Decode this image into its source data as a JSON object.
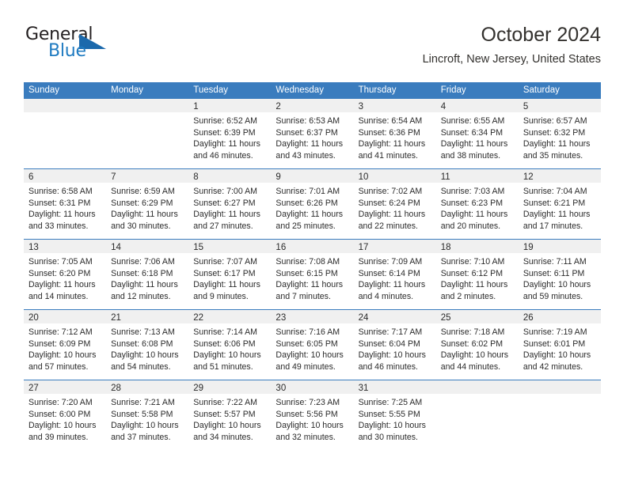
{
  "brand": {
    "name_part1": "General",
    "name_part2": "Blue",
    "triangle_icon": "triangle-icon",
    "accent_color": "#1b69ac"
  },
  "header": {
    "title": "October 2024",
    "location": "Lincroft, New Jersey, United States"
  },
  "calendar": {
    "header_bg": "#3a7cbe",
    "day_band_bg": "#f0f0f0",
    "weekdays": [
      "Sunday",
      "Monday",
      "Tuesday",
      "Wednesday",
      "Thursday",
      "Friday",
      "Saturday"
    ],
    "weeks": [
      [
        {
          "day": "",
          "lines": []
        },
        {
          "day": "",
          "lines": []
        },
        {
          "day": "1",
          "lines": [
            "Sunrise: 6:52 AM",
            "Sunset: 6:39 PM",
            "Daylight: 11 hours",
            "and 46 minutes."
          ]
        },
        {
          "day": "2",
          "lines": [
            "Sunrise: 6:53 AM",
            "Sunset: 6:37 PM",
            "Daylight: 11 hours",
            "and 43 minutes."
          ]
        },
        {
          "day": "3",
          "lines": [
            "Sunrise: 6:54 AM",
            "Sunset: 6:36 PM",
            "Daylight: 11 hours",
            "and 41 minutes."
          ]
        },
        {
          "day": "4",
          "lines": [
            "Sunrise: 6:55 AM",
            "Sunset: 6:34 PM",
            "Daylight: 11 hours",
            "and 38 minutes."
          ]
        },
        {
          "day": "5",
          "lines": [
            "Sunrise: 6:57 AM",
            "Sunset: 6:32 PM",
            "Daylight: 11 hours",
            "and 35 minutes."
          ]
        }
      ],
      [
        {
          "day": "6",
          "lines": [
            "Sunrise: 6:58 AM",
            "Sunset: 6:31 PM",
            "Daylight: 11 hours",
            "and 33 minutes."
          ]
        },
        {
          "day": "7",
          "lines": [
            "Sunrise: 6:59 AM",
            "Sunset: 6:29 PM",
            "Daylight: 11 hours",
            "and 30 minutes."
          ]
        },
        {
          "day": "8",
          "lines": [
            "Sunrise: 7:00 AM",
            "Sunset: 6:27 PM",
            "Daylight: 11 hours",
            "and 27 minutes."
          ]
        },
        {
          "day": "9",
          "lines": [
            "Sunrise: 7:01 AM",
            "Sunset: 6:26 PM",
            "Daylight: 11 hours",
            "and 25 minutes."
          ]
        },
        {
          "day": "10",
          "lines": [
            "Sunrise: 7:02 AM",
            "Sunset: 6:24 PM",
            "Daylight: 11 hours",
            "and 22 minutes."
          ]
        },
        {
          "day": "11",
          "lines": [
            "Sunrise: 7:03 AM",
            "Sunset: 6:23 PM",
            "Daylight: 11 hours",
            "and 20 minutes."
          ]
        },
        {
          "day": "12",
          "lines": [
            "Sunrise: 7:04 AM",
            "Sunset: 6:21 PM",
            "Daylight: 11 hours",
            "and 17 minutes."
          ]
        }
      ],
      [
        {
          "day": "13",
          "lines": [
            "Sunrise: 7:05 AM",
            "Sunset: 6:20 PM",
            "Daylight: 11 hours",
            "and 14 minutes."
          ]
        },
        {
          "day": "14",
          "lines": [
            "Sunrise: 7:06 AM",
            "Sunset: 6:18 PM",
            "Daylight: 11 hours",
            "and 12 minutes."
          ]
        },
        {
          "day": "15",
          "lines": [
            "Sunrise: 7:07 AM",
            "Sunset: 6:17 PM",
            "Daylight: 11 hours",
            "and 9 minutes."
          ]
        },
        {
          "day": "16",
          "lines": [
            "Sunrise: 7:08 AM",
            "Sunset: 6:15 PM",
            "Daylight: 11 hours",
            "and 7 minutes."
          ]
        },
        {
          "day": "17",
          "lines": [
            "Sunrise: 7:09 AM",
            "Sunset: 6:14 PM",
            "Daylight: 11 hours",
            "and 4 minutes."
          ]
        },
        {
          "day": "18",
          "lines": [
            "Sunrise: 7:10 AM",
            "Sunset: 6:12 PM",
            "Daylight: 11 hours",
            "and 2 minutes."
          ]
        },
        {
          "day": "19",
          "lines": [
            "Sunrise: 7:11 AM",
            "Sunset: 6:11 PM",
            "Daylight: 10 hours",
            "and 59 minutes."
          ]
        }
      ],
      [
        {
          "day": "20",
          "lines": [
            "Sunrise: 7:12 AM",
            "Sunset: 6:09 PM",
            "Daylight: 10 hours",
            "and 57 minutes."
          ]
        },
        {
          "day": "21",
          "lines": [
            "Sunrise: 7:13 AM",
            "Sunset: 6:08 PM",
            "Daylight: 10 hours",
            "and 54 minutes."
          ]
        },
        {
          "day": "22",
          "lines": [
            "Sunrise: 7:14 AM",
            "Sunset: 6:06 PM",
            "Daylight: 10 hours",
            "and 51 minutes."
          ]
        },
        {
          "day": "23",
          "lines": [
            "Sunrise: 7:16 AM",
            "Sunset: 6:05 PM",
            "Daylight: 10 hours",
            "and 49 minutes."
          ]
        },
        {
          "day": "24",
          "lines": [
            "Sunrise: 7:17 AM",
            "Sunset: 6:04 PM",
            "Daylight: 10 hours",
            "and 46 minutes."
          ]
        },
        {
          "day": "25",
          "lines": [
            "Sunrise: 7:18 AM",
            "Sunset: 6:02 PM",
            "Daylight: 10 hours",
            "and 44 minutes."
          ]
        },
        {
          "day": "26",
          "lines": [
            "Sunrise: 7:19 AM",
            "Sunset: 6:01 PM",
            "Daylight: 10 hours",
            "and 42 minutes."
          ]
        }
      ],
      [
        {
          "day": "27",
          "lines": [
            "Sunrise: 7:20 AM",
            "Sunset: 6:00 PM",
            "Daylight: 10 hours",
            "and 39 minutes."
          ]
        },
        {
          "day": "28",
          "lines": [
            "Sunrise: 7:21 AM",
            "Sunset: 5:58 PM",
            "Daylight: 10 hours",
            "and 37 minutes."
          ]
        },
        {
          "day": "29",
          "lines": [
            "Sunrise: 7:22 AM",
            "Sunset: 5:57 PM",
            "Daylight: 10 hours",
            "and 34 minutes."
          ]
        },
        {
          "day": "30",
          "lines": [
            "Sunrise: 7:23 AM",
            "Sunset: 5:56 PM",
            "Daylight: 10 hours",
            "and 32 minutes."
          ]
        },
        {
          "day": "31",
          "lines": [
            "Sunrise: 7:25 AM",
            "Sunset: 5:55 PM",
            "Daylight: 10 hours",
            "and 30 minutes."
          ]
        },
        {
          "day": "",
          "lines": []
        },
        {
          "day": "",
          "lines": []
        }
      ]
    ]
  }
}
